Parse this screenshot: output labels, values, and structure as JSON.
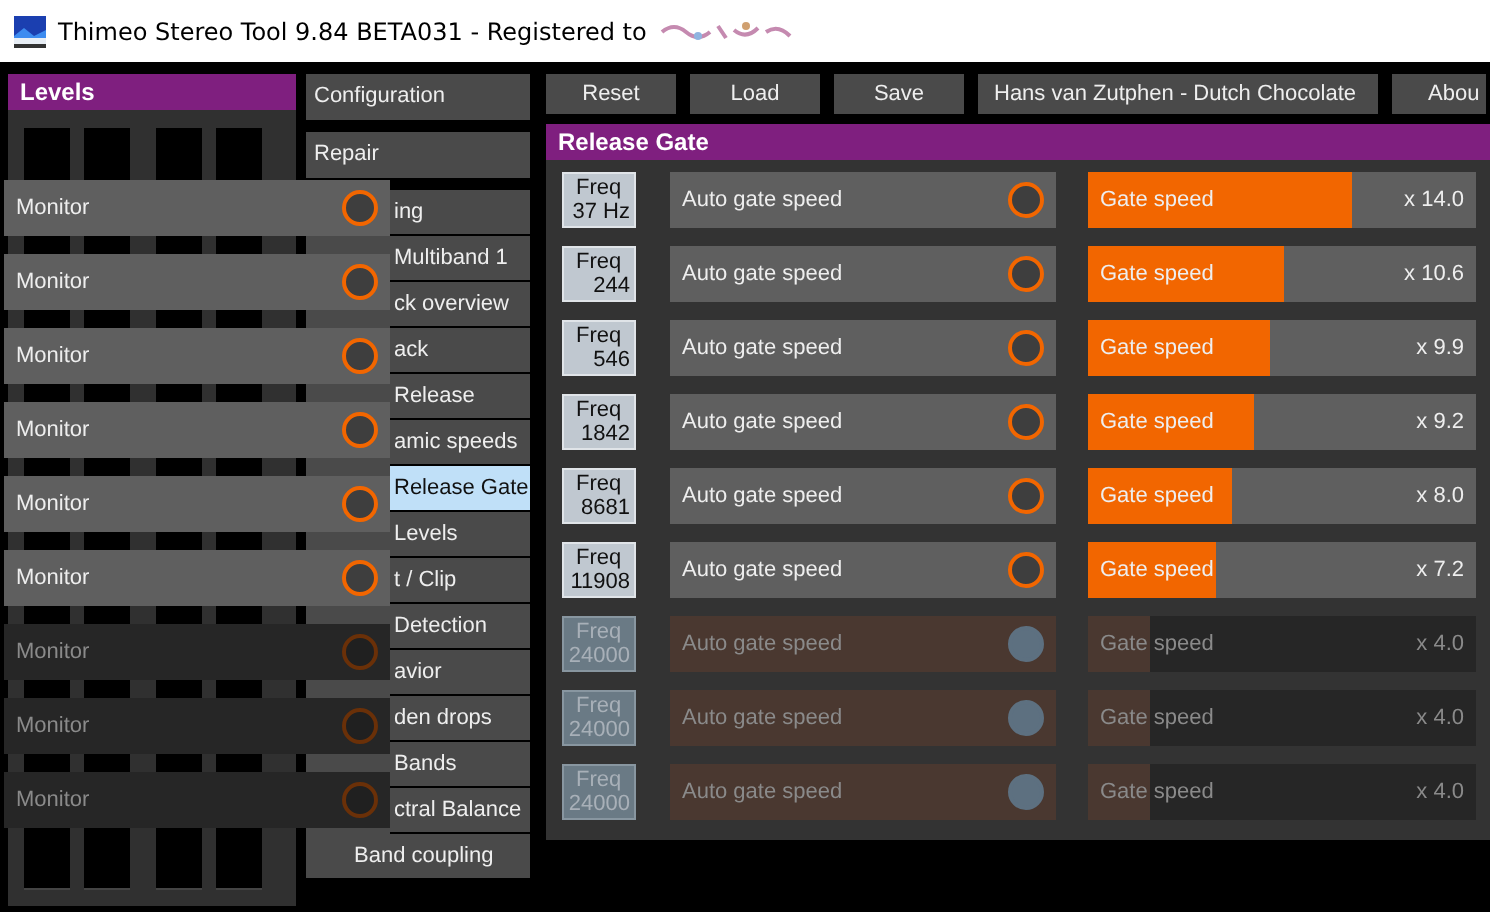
{
  "window": {
    "title": "Thimeo Stereo Tool 9.84 BETA031 - Registered to"
  },
  "levels_panel": {
    "title": "Levels",
    "monitors": [
      {
        "label": "Monitor",
        "disabled": false
      },
      {
        "label": "Monitor",
        "disabled": false
      },
      {
        "label": "Monitor",
        "disabled": false
      },
      {
        "label": "Monitor",
        "disabled": false
      },
      {
        "label": "Monitor",
        "disabled": false
      },
      {
        "label": "Monitor",
        "disabled": false
      },
      {
        "label": "Monitor",
        "disabled": true
      },
      {
        "label": "Monitor",
        "disabled": true
      },
      {
        "label": "Monitor",
        "disabled": true
      }
    ]
  },
  "menu": [
    {
      "label": "Configuration",
      "kind": "top",
      "selected": false
    },
    {
      "label": "Repair",
      "kind": "top",
      "selected": false
    },
    {
      "label": "ing",
      "kind": "cut",
      "selected": false
    },
    {
      "label": "Multiband 1",
      "kind": "cut",
      "selected": false
    },
    {
      "label": "ck overview",
      "kind": "cut",
      "selected": false
    },
    {
      "label": "ack",
      "kind": "cut",
      "selected": false
    },
    {
      "label": "Release",
      "kind": "cut",
      "selected": false
    },
    {
      "label": "amic speeds",
      "kind": "cut",
      "selected": false
    },
    {
      "label": "Release Gate",
      "kind": "cut",
      "selected": true
    },
    {
      "label": "Levels",
      "kind": "cut",
      "selected": false
    },
    {
      "label": "t / Clip",
      "kind": "cut",
      "selected": false
    },
    {
      "label": "Detection",
      "kind": "cut",
      "selected": false
    },
    {
      "label": "avior",
      "kind": "cut",
      "selected": false
    },
    {
      "label": "den drops",
      "kind": "cut",
      "selected": false
    },
    {
      "label": "Bands",
      "kind": "cut",
      "selected": false
    },
    {
      "label": "ctral Balance",
      "kind": "cut",
      "selected": false
    },
    {
      "label": "Band coupling",
      "kind": "full",
      "selected": false
    }
  ],
  "toolbar": {
    "buttons": [
      "Reset",
      "Load",
      "Save"
    ],
    "preset": "Hans van Zutphen - Dutch Chocolate",
    "about": "Abou"
  },
  "release_gate": {
    "title": "Release Gate",
    "bands": [
      {
        "freq_label": "Freq",
        "freq": "37 Hz",
        "auto_label": "Auto gate speed",
        "disabled": false,
        "slider_label": "Gate speed",
        "level": 0.68,
        "reading": "x 14.0"
      },
      {
        "freq_label": "Freq",
        "freq": "244",
        "auto_label": "Auto gate speed",
        "disabled": false,
        "slider_label": "Gate speed",
        "level": 0.505,
        "reading": "x 10.6"
      },
      {
        "freq_label": "Freq",
        "freq": "546",
        "auto_label": "Auto gate speed",
        "disabled": false,
        "slider_label": "Gate speed",
        "level": 0.47,
        "reading": "x 9.9"
      },
      {
        "freq_label": "Freq",
        "freq": "1842",
        "auto_label": "Auto gate speed",
        "disabled": false,
        "slider_label": "Gate speed",
        "level": 0.43,
        "reading": "x 9.2"
      },
      {
        "freq_label": "Freq",
        "freq": "8681",
        "auto_label": "Auto gate speed",
        "disabled": false,
        "slider_label": "Gate speed",
        "level": 0.37,
        "reading": "x 8.0"
      },
      {
        "freq_label": "Freq",
        "freq": "11908",
        "auto_label": "Auto gate speed",
        "disabled": false,
        "slider_label": "Gate speed",
        "level": 0.33,
        "reading": "x 7.2"
      },
      {
        "freq_label": "Freq",
        "freq": "24000",
        "auto_label": "Auto gate speed",
        "disabled": true,
        "slider_label": "Gate speed",
        "level": 0.16,
        "reading": "x 4.0"
      },
      {
        "freq_label": "Freq",
        "freq": "24000",
        "auto_label": "Auto gate speed",
        "disabled": true,
        "slider_label": "Gate speed",
        "level": 0.16,
        "reading": "x 4.0"
      },
      {
        "freq_label": "Freq",
        "freq": "24000",
        "auto_label": "Auto gate speed",
        "disabled": true,
        "slider_label": "Gate speed",
        "level": 0.16,
        "reading": "x 4.0"
      }
    ]
  }
}
